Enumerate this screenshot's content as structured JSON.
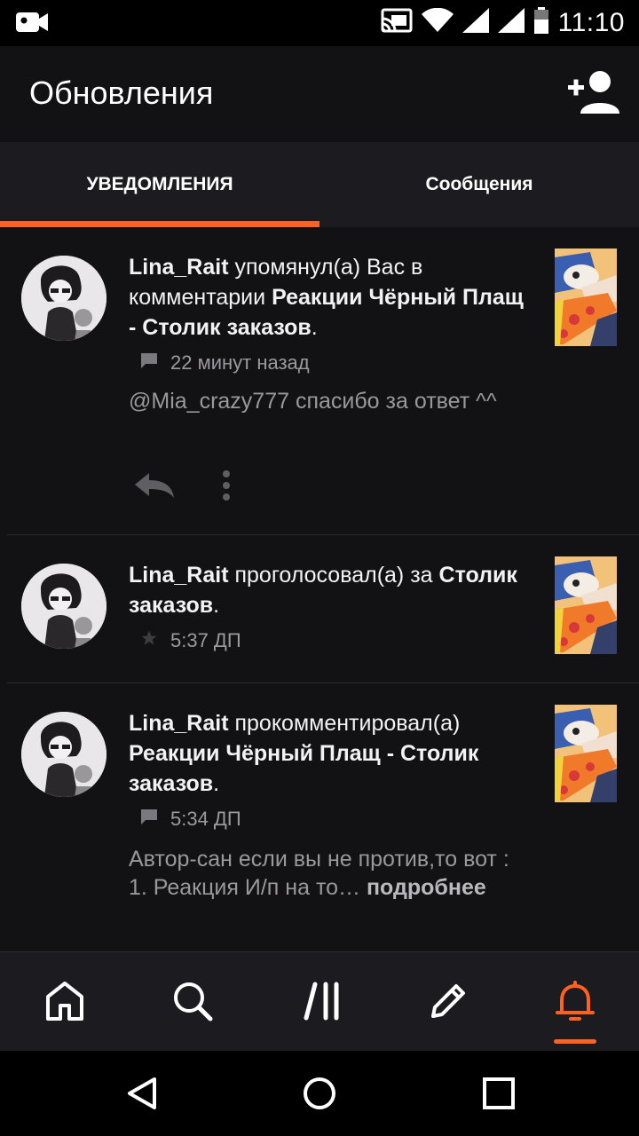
{
  "status_bar": {
    "time": "11:10"
  },
  "app_bar": {
    "title": "Обновления"
  },
  "tabs": [
    {
      "label": "УВЕДОМЛЕНИЯ",
      "active": true
    },
    {
      "label": "Сообщения",
      "active": false
    }
  ],
  "notifications": [
    {
      "user": "Lina_Rait",
      "action": " упомянул(а) Вас в комментарии ",
      "target": "Реакции Чёрный Плащ - Столик заказов",
      "suffix": ".",
      "meta_icon": "comment-icon",
      "time": "22 минут назад",
      "snippet": "@Mia_crazy777 спасибо за ответ ^^",
      "more": ""
    },
    {
      "user": "Lina_Rait",
      "action": " проголосовал(а) за ",
      "target": "Столик заказов",
      "suffix": ".",
      "meta_icon": "star-icon",
      "time": "5:37 ДП"
    },
    {
      "user": "Lina_Rait",
      "action": " прокомментировал(а) ",
      "target": "Реакции Чёрный Плащ - Столик заказов",
      "suffix": ".",
      "meta_icon": "comment-icon",
      "time": "5:34 ДП",
      "snippet": "Автор-сан если вы не против,то вот : 1. Реакция И/п на то…",
      "more": " подробнее"
    }
  ],
  "colors": {
    "accent": "#ff6122",
    "background": "#121114",
    "surface": "#1c1b1f"
  },
  "bottom_nav": [
    "home-icon",
    "search-icon",
    "library-icon",
    "write-icon",
    "notifications-icon"
  ]
}
